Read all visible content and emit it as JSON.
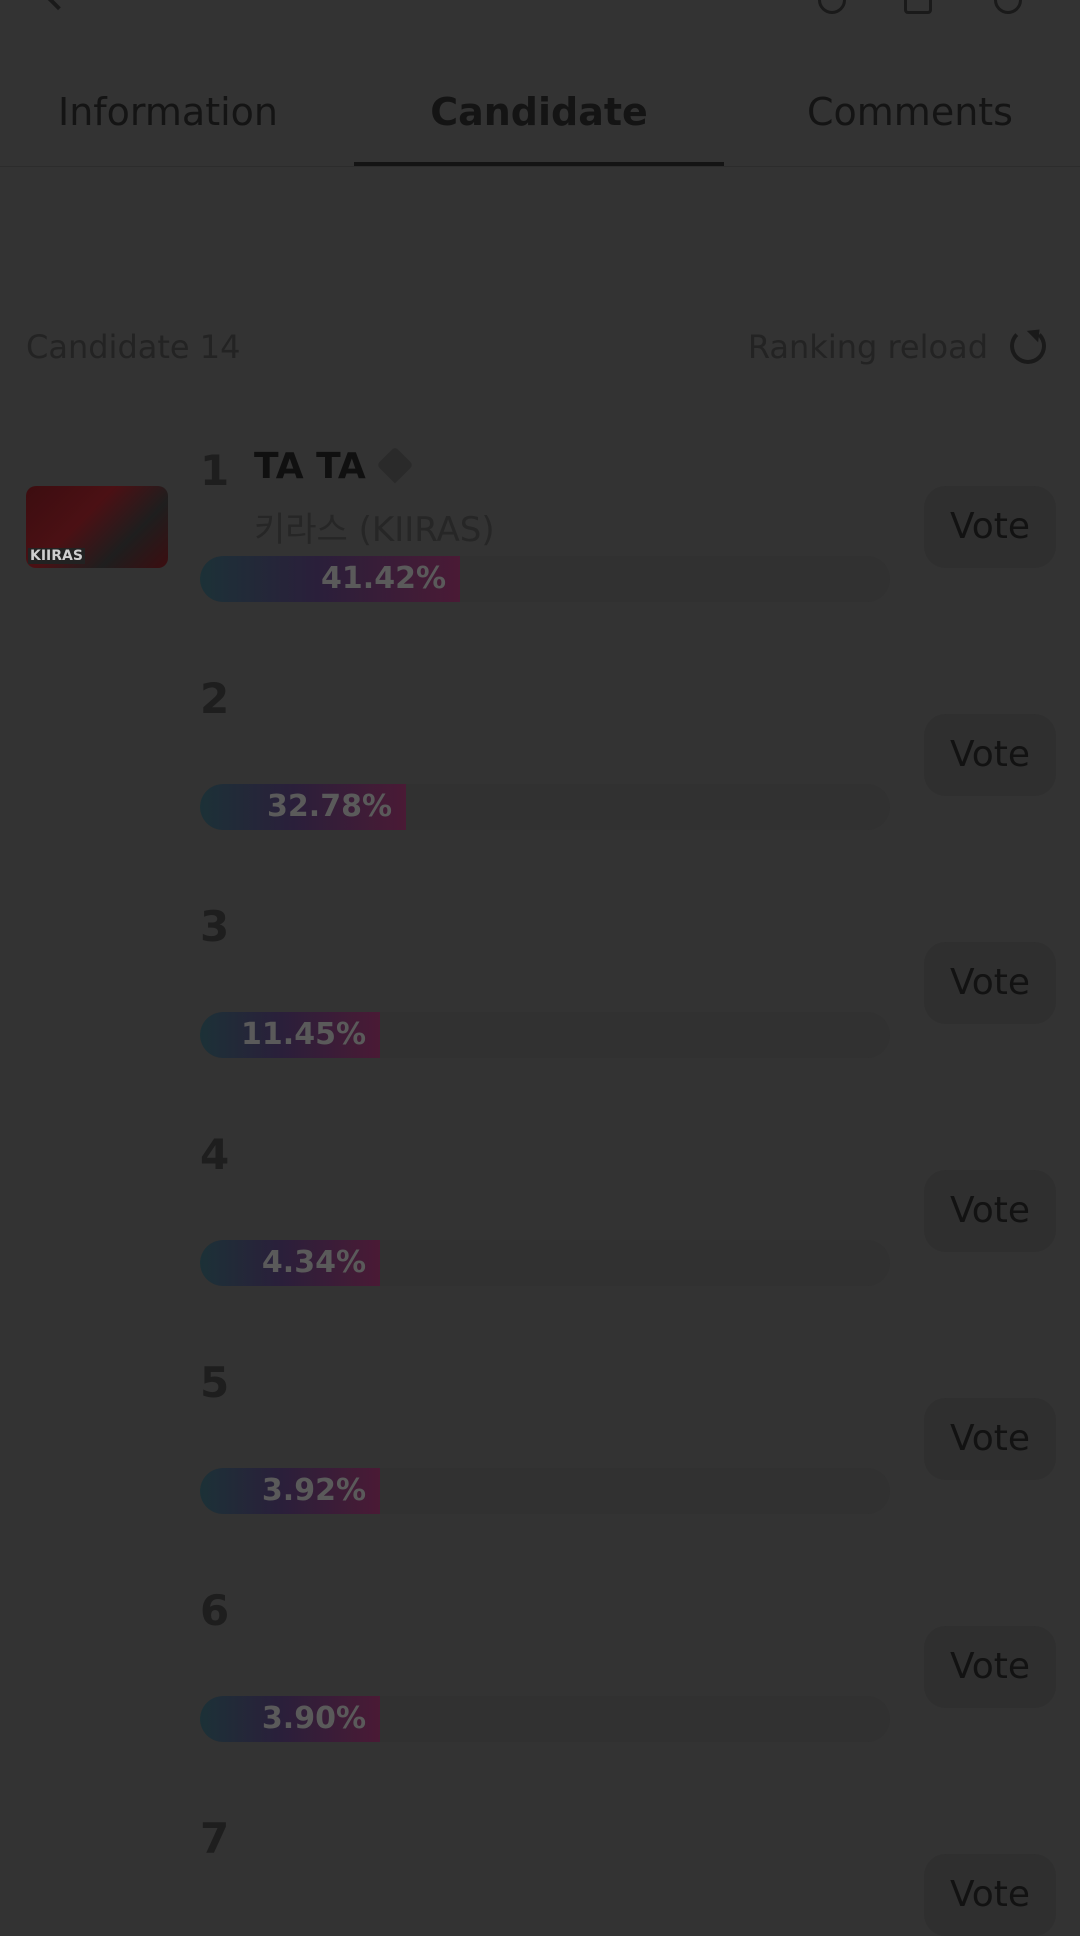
{
  "tabs": {
    "information": "Information",
    "candidate": "Candidate",
    "comments": "Comments"
  },
  "header": {
    "candidate_count": "Candidate 14",
    "ranking_reload": "Ranking reload"
  },
  "candidates": [
    {
      "rank": "1",
      "name": "TA TA",
      "group": "키라스 (KIIRAS)",
      "percent_label": "41.42%",
      "percent": 41.42,
      "vote_label": "Vote",
      "thumb_text": "KIIRAS"
    },
    {
      "rank": "2",
      "name": "",
      "group": "",
      "percent_label": "32.78%",
      "percent": 32.78,
      "vote_label": "Vote"
    },
    {
      "rank": "3",
      "name": "",
      "group": "",
      "percent_label": "11.45%",
      "percent": 11.45,
      "vote_label": "Vote"
    },
    {
      "rank": "4",
      "name": "",
      "group": "",
      "percent_label": "4.34%",
      "percent": 4.34,
      "vote_label": "Vote"
    },
    {
      "rank": "5",
      "name": "",
      "group": "",
      "percent_label": "3.92%",
      "percent": 3.92,
      "vote_label": "Vote"
    },
    {
      "rank": "6",
      "name": "",
      "group": "",
      "percent_label": "3.90%",
      "percent": 3.9,
      "vote_label": "Vote"
    },
    {
      "rank": "7",
      "name": "",
      "group": "",
      "percent_label": "",
      "percent": 0,
      "vote_label": "Vote"
    }
  ],
  "colors": {
    "background": "#333333",
    "bar_track": "#313131",
    "bar_start": "#1c3137",
    "bar_end": "#4a1a35"
  },
  "icons": {
    "back": "back-arrow-icon",
    "share": "share-icon",
    "notifications": "bell-icon",
    "more": "more-icon",
    "reload": "reload-icon",
    "pin": "pin-icon"
  }
}
